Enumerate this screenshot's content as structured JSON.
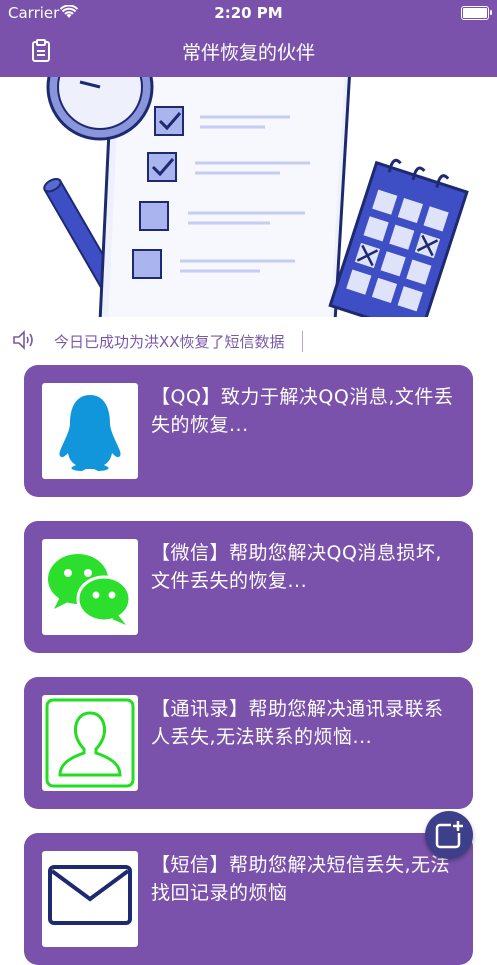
{
  "status_bar": {
    "carrier": "Carrier",
    "time": "2:20 PM"
  },
  "nav": {
    "title": "常伴恢复的伙伴",
    "left_icon": "clipboard-icon"
  },
  "notice": {
    "icon": "speaker-icon",
    "text": "今日已成功为洪XX恢复了短信数据"
  },
  "services": [
    {
      "icon": "qq-penguin-icon",
      "text": "【QQ】致力于解决QQ消息,文件丢失的恢复..."
    },
    {
      "icon": "wechat-icon",
      "text": "【微信】帮助您解决QQ消息损坏,文件丢失的恢复..."
    },
    {
      "icon": "contacts-icon",
      "text": "【通讯录】帮助您解决通讯录联系人丢失,无法联系的烦恼..."
    },
    {
      "icon": "envelope-icon",
      "text": "【短信】帮助您解决短信丢失,无法找回记录的烦恼"
    }
  ],
  "colors": {
    "primary": "#7b52ab",
    "accent_text": "#7a5aa8",
    "float_button": "#3e3f8a"
  }
}
